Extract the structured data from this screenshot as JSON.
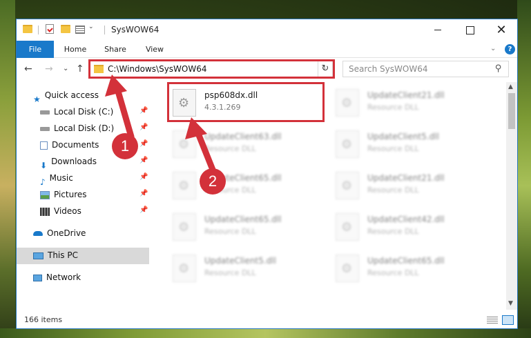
{
  "window": {
    "title": "SysWOW64",
    "buttons": {
      "minimize": "",
      "maximize": "",
      "close": "✕"
    }
  },
  "ribbon": {
    "tabs": [
      "File",
      "Home",
      "Share",
      "View"
    ],
    "collapse_glyph": "⌄",
    "help_glyph": "?"
  },
  "nav": {
    "back_glyph": "←",
    "forward_glyph": "→",
    "recent_glyph": "⌄",
    "up_glyph": "↑",
    "address_path": "C:\\Windows\\SysWOW64",
    "address_dropdown_glyph": "⌄",
    "refresh_glyph": "↻",
    "search_placeholder": "Search SysWOW64",
    "search_glyph": "⚲"
  },
  "sidebar": {
    "items": [
      {
        "label": "Quick access",
        "icon": "star-icon",
        "pinned": false
      },
      {
        "label": "Local Disk (C:)",
        "icon": "drive-icon",
        "pinned": true
      },
      {
        "label": "Local Disk (D:)",
        "icon": "drive-icon",
        "pinned": true
      },
      {
        "label": "Documents",
        "icon": "documents-icon",
        "pinned": true
      },
      {
        "label": "Downloads",
        "icon": "download-icon",
        "pinned": true
      },
      {
        "label": "Music",
        "icon": "music-icon",
        "pinned": true
      },
      {
        "label": "Pictures",
        "icon": "pictures-icon",
        "pinned": true
      },
      {
        "label": "Videos",
        "icon": "videos-icon",
        "pinned": true
      },
      {
        "label": "OneDrive",
        "icon": "cloud-icon",
        "pinned": false
      },
      {
        "label": "This PC",
        "icon": "computer-icon",
        "pinned": false,
        "selected": true
      },
      {
        "label": "Network",
        "icon": "network-icon",
        "pinned": false
      }
    ],
    "pin_glyph": "📌"
  },
  "files": [
    {
      "name": "psp608dx.dll",
      "sub": "4.3.1.269",
      "highlighted": true
    },
    {
      "name": "UpdateClient21.dll",
      "sub": "Resource DLL"
    },
    {
      "name": "UpdateClient63.dll",
      "sub": "Resource DLL"
    },
    {
      "name": "UpdateClient5.dll",
      "sub": "Resource DLL"
    },
    {
      "name": "UpdateClient65.dll",
      "sub": "Resource DLL"
    },
    {
      "name": "UpdateClient21.dll",
      "sub": "Resource DLL"
    },
    {
      "name": "UpdateClient65.dll",
      "sub": "Resource DLL"
    },
    {
      "name": "UpdateClient42.dll",
      "sub": "Resource DLL"
    },
    {
      "name": "UpdateClient5.dll",
      "sub": "Resource DLL"
    },
    {
      "name": "UpdateClient65.dll",
      "sub": "Resource DLL"
    }
  ],
  "status": {
    "item_count": "166 items"
  },
  "scroll": {
    "up_glyph": "▲",
    "down_glyph": "▼"
  },
  "callouts": {
    "one": "1",
    "two": "2"
  },
  "colors": {
    "accent": "#1979ca",
    "highlight_red": "#d3313a"
  }
}
